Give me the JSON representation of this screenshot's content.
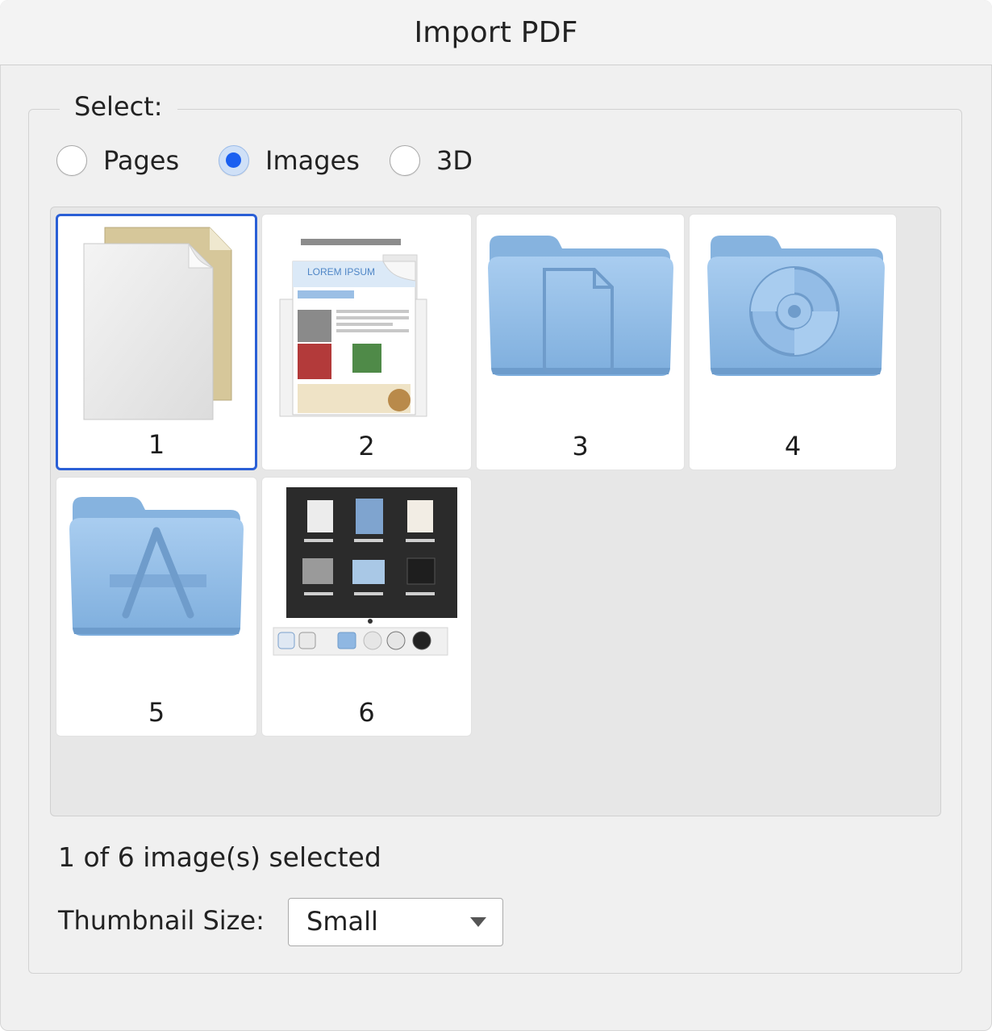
{
  "window": {
    "title": "Import PDF"
  },
  "select_group": {
    "legend": "Select:",
    "options": [
      {
        "label": "Pages",
        "checked": false
      },
      {
        "label": "Images",
        "checked": true
      },
      {
        "label": "3D",
        "checked": false
      }
    ]
  },
  "gallery": {
    "items": [
      {
        "label": "1",
        "icon": "generic-document-icon",
        "selected": true
      },
      {
        "label": "2",
        "icon": "newsletter-document-icon",
        "selected": false
      },
      {
        "label": "3",
        "icon": "documents-folder-icon",
        "selected": false
      },
      {
        "label": "4",
        "icon": "disc-folder-icon",
        "selected": false
      },
      {
        "label": "5",
        "icon": "applications-folder-icon",
        "selected": false
      },
      {
        "label": "6",
        "icon": "photo-gallery-screenshot-icon",
        "selected": false
      }
    ]
  },
  "status_text": "1 of 6 image(s) selected",
  "thumbnail_size": {
    "label": "Thumbnail Size:",
    "selected": "Small"
  },
  "colors": {
    "accent": "#1a5ff0",
    "selection_border": "#2a5fd6",
    "folder_blue": "#8fb9e4"
  }
}
